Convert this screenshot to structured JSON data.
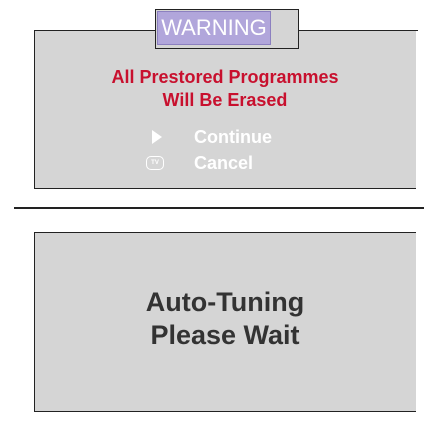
{
  "warning_dialog": {
    "title": "WARNING",
    "message_line1": "All Prestored Programmes",
    "message_line2": "Will Be Erased",
    "options": [
      {
        "icon": "play-icon",
        "label": "Continue"
      },
      {
        "icon": "tv-icon",
        "label": "Cancel",
        "icon_text": "TV"
      }
    ],
    "colors": {
      "panel_bg": "#d5d5d5",
      "title_bg": "#b1a6db",
      "message": "#c8102e",
      "option_text": "#ffffff"
    }
  },
  "tuning_dialog": {
    "message_line1": "Auto-Tuning",
    "message_line2": "Please Wait",
    "colors": {
      "panel_bg": "#d5d5d5",
      "text": "#333333"
    }
  }
}
